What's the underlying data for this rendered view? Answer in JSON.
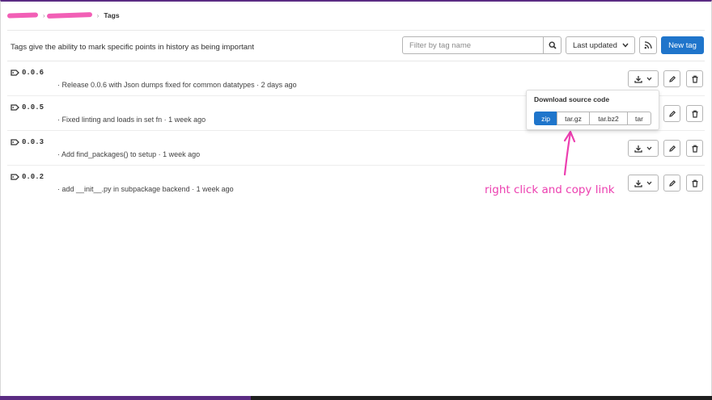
{
  "breadcrumb": {
    "current": "Tags"
  },
  "header": {
    "description": "Tags give the ability to mark specific points in history as being important"
  },
  "filter": {
    "placeholder": "Filter by tag name"
  },
  "sort": {
    "label": "Last updated"
  },
  "new_tag_label": "New tag",
  "tags": [
    {
      "name": "0.0.6",
      "message": "· Release 0.0.6 with Json dumps fixed for common datatypes · 2 days ago"
    },
    {
      "name": "0.0.5",
      "message": "· Fixed linting and loads in set fn · 1 week ago"
    },
    {
      "name": "0.0.3",
      "message": "· Add find_packages() to setup · 1 week ago"
    },
    {
      "name": "0.0.2",
      "message": "· add __init__.py in subpackage backend · 1 week ago"
    }
  ],
  "download_dropdown": {
    "title": "Download source code",
    "formats": [
      "zip",
      "tar.gz",
      "tar.bz2",
      "tar"
    ],
    "selected": "zip"
  },
  "annotation": {
    "text": "right click and copy link"
  },
  "colors": {
    "primary": "#1f75cb",
    "annotation": "#ec3fb0",
    "redaction": "#f25fb6",
    "frame": "#5b2c83"
  },
  "icons": [
    "chevron-right-icon",
    "search-icon",
    "chevron-down-icon",
    "rss-icon",
    "tag-icon",
    "download-icon",
    "pencil-icon",
    "trash-icon",
    "arrow-icon"
  ]
}
